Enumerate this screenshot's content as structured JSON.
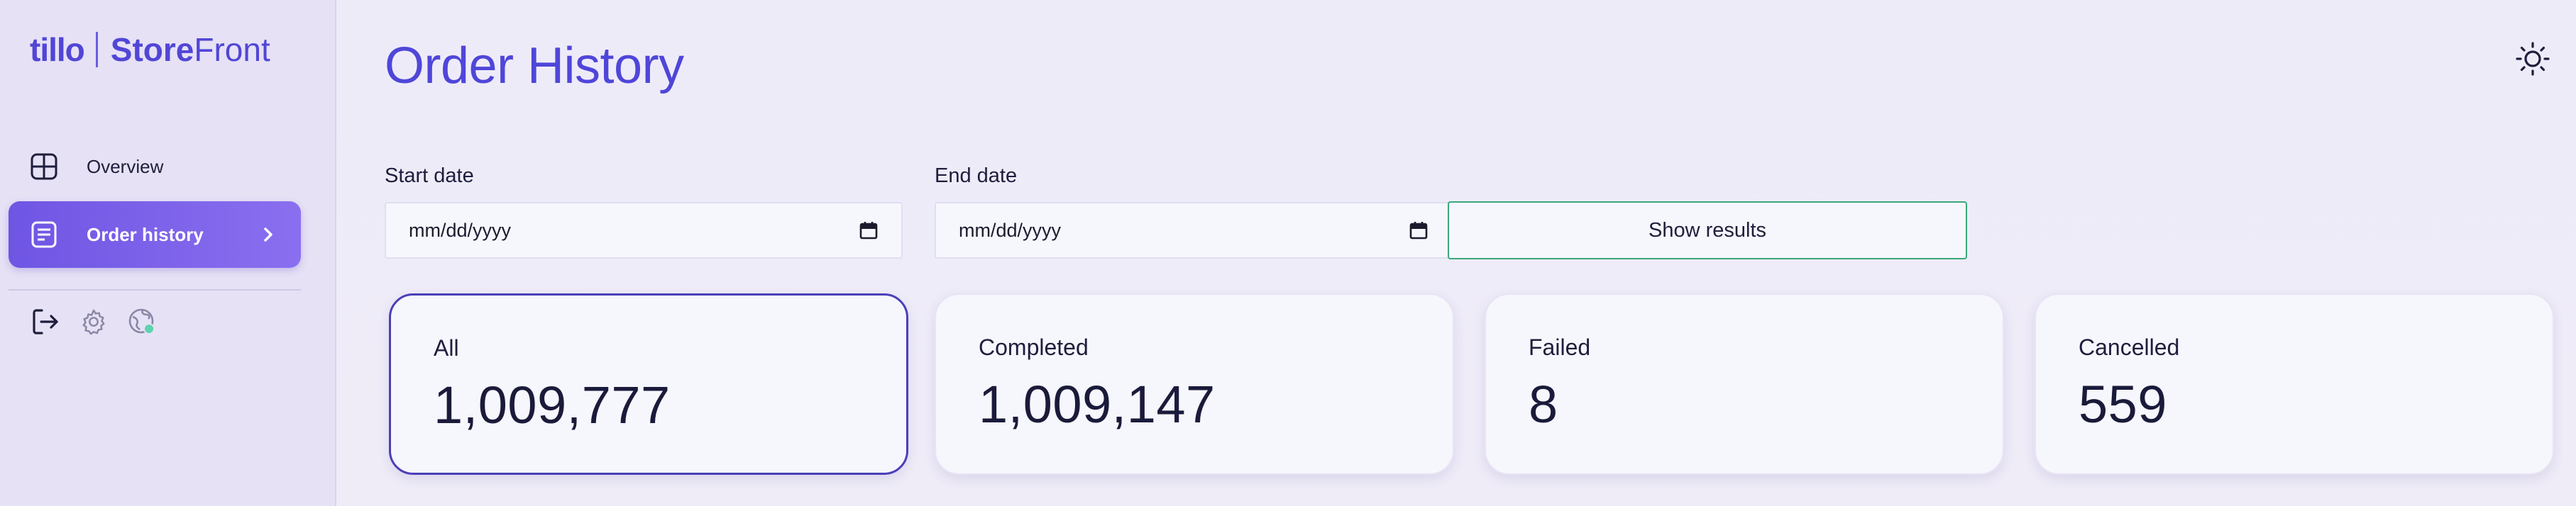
{
  "brand": {
    "mark": "tillo",
    "name_bold": "Store",
    "name_light": "Front"
  },
  "sidebar": {
    "items": [
      {
        "label": "Overview",
        "icon": "grid-icon",
        "active": false
      },
      {
        "label": "Order history",
        "icon": "document-icon",
        "active": true
      }
    ],
    "tools": [
      "logout-icon",
      "gear-icon",
      "globe-icon"
    ]
  },
  "page": {
    "title": "Order History"
  },
  "filters": {
    "start_label": "Start date",
    "start_value": "mm/dd/yyyy",
    "end_label": "End date",
    "end_value": "mm/dd/yyyy",
    "submit_label": "Show results"
  },
  "stats": [
    {
      "label": "All",
      "value": "1,009,777",
      "selected": true
    },
    {
      "label": "Completed",
      "value": "1,009,147",
      "selected": false
    },
    {
      "label": "Failed",
      "value": "8",
      "selected": false
    },
    {
      "label": "Cancelled",
      "value": "559",
      "selected": false
    }
  ],
  "colors": {
    "accent": "#4f46d9",
    "active_nav_start": "#6f55e3",
    "active_nav_end": "#8a6ff0",
    "button_border": "#3aa97b",
    "selected_card_border": "#4a3fb8"
  }
}
